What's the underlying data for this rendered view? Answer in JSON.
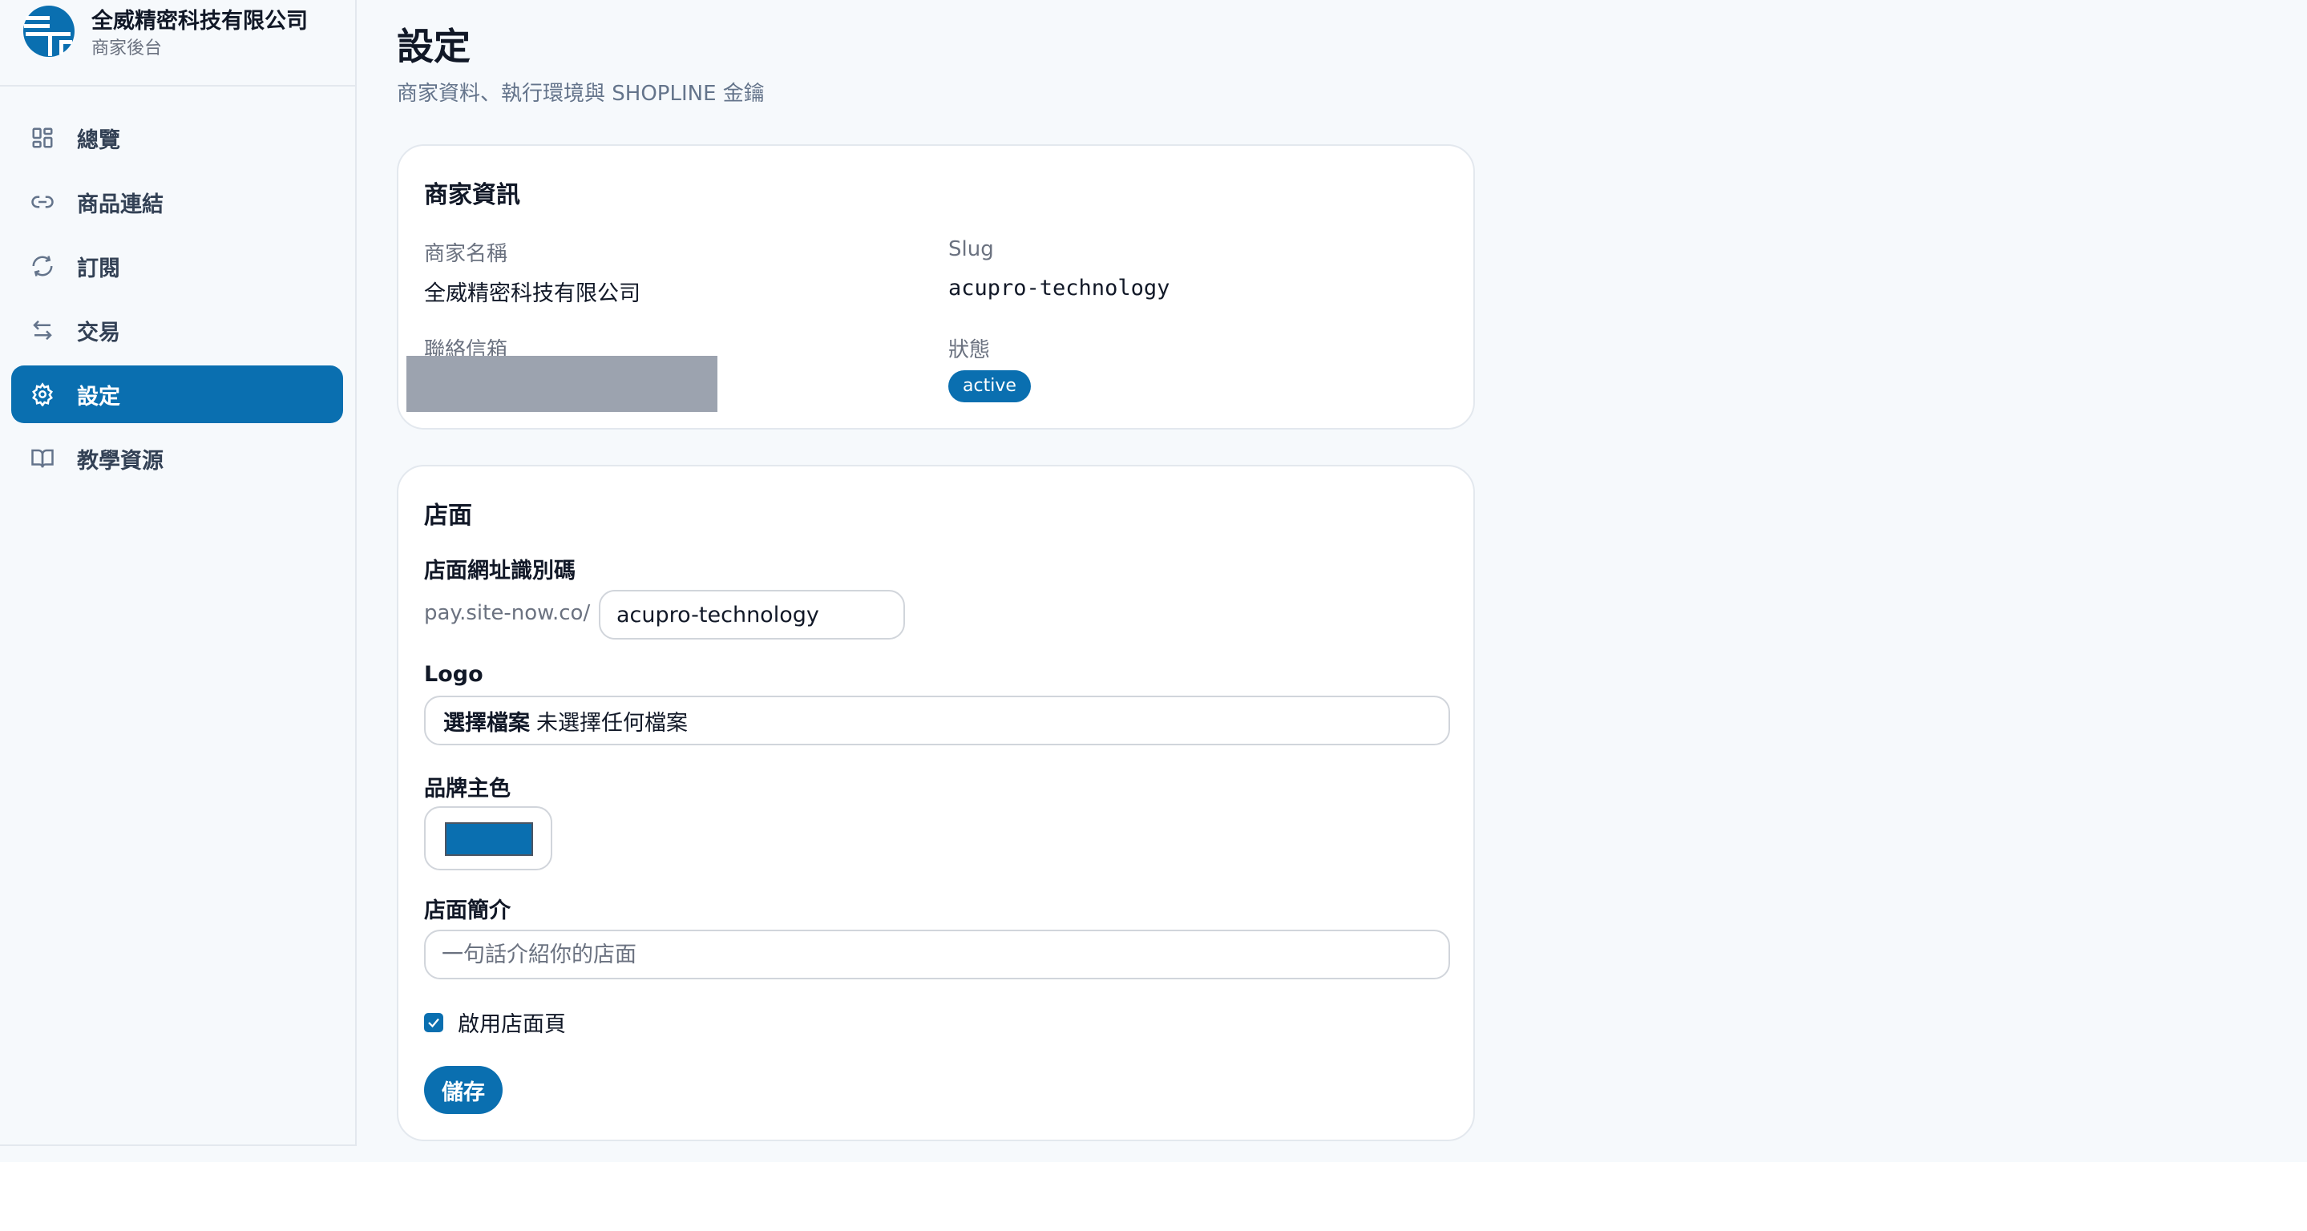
{
  "brand": {
    "name": "全威精密科技有限公司",
    "subtitle": "商家後台",
    "accent": "#0a6fb0"
  },
  "sidebar": {
    "items": [
      {
        "label": "總覽",
        "icon": "grid-icon",
        "active": false
      },
      {
        "label": "商品連結",
        "icon": "link-icon",
        "active": false
      },
      {
        "label": "訂閱",
        "icon": "refresh-icon",
        "active": false
      },
      {
        "label": "交易",
        "icon": "swap-icon",
        "active": false
      },
      {
        "label": "設定",
        "icon": "gear-icon",
        "active": true
      },
      {
        "label": "教學資源",
        "icon": "book-icon",
        "active": false
      }
    ]
  },
  "header": {
    "title": "設定",
    "subtitle": "商家資料、執行環境與 SHOPLINE 金鑰"
  },
  "merchant_info": {
    "title": "商家資訊",
    "name_label": "商家名稱",
    "name_value": "全威精密科技有限公司",
    "slug_label": "Slug",
    "slug_value": "acupro-technology",
    "email_label": "聯絡信箱",
    "status_label": "狀態",
    "status_value": "active"
  },
  "storefront": {
    "title": "店面",
    "slug_label": "店面網址識別碼",
    "url_prefix": "pay.site-now.co/",
    "slug_value": "acupro-technology",
    "logo_label": "Logo",
    "file_button": "選擇檔案",
    "file_status": "未選擇任何檔案",
    "color_label": "品牌主色",
    "brand_color": "#0a6fb0",
    "intro_label": "店面簡介",
    "intro_placeholder": "一句話介紹你的店面",
    "enable_label": "啟用店面頁",
    "enable_checked": true,
    "save_label": "儲存"
  }
}
